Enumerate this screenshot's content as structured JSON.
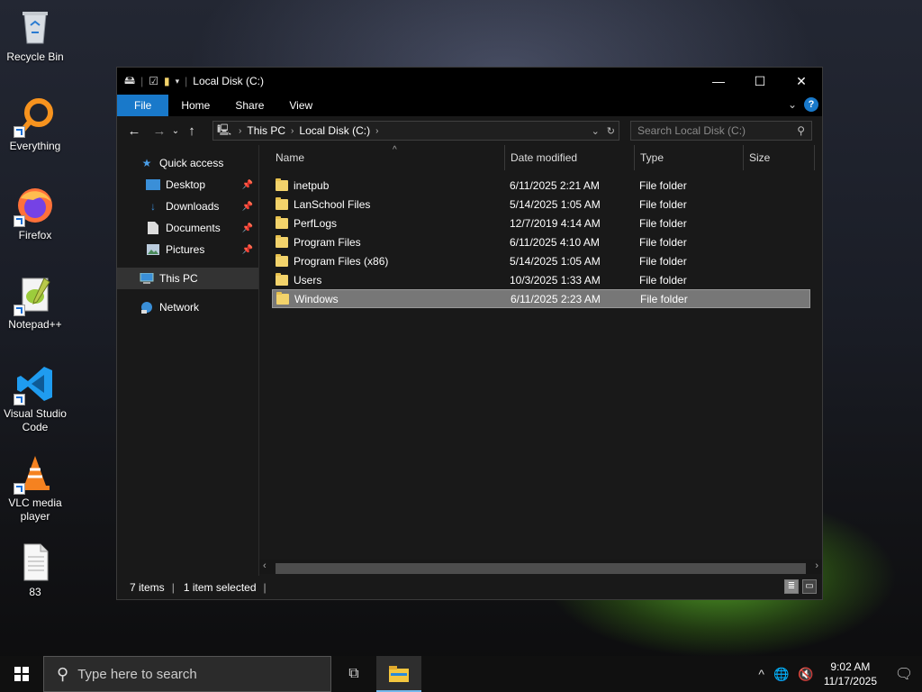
{
  "desktop": {
    "icons": [
      {
        "label": "Recycle Bin"
      },
      {
        "label": "Everything"
      },
      {
        "label": "Firefox"
      },
      {
        "label": "Notepad++"
      },
      {
        "label": "Visual Studio Code"
      },
      {
        "label": "VLC media player"
      },
      {
        "label": "83"
      }
    ]
  },
  "window": {
    "title": "Local Disk (C:)",
    "ribbon_tabs": [
      "File",
      "Home",
      "Share",
      "View"
    ],
    "address": {
      "crumbs": [
        "This PC",
        "Local Disk (C:)"
      ]
    },
    "search": {
      "placeholder": "Search Local Disk (C:)"
    },
    "sidebar": {
      "quick_access": "Quick access",
      "pinned": [
        {
          "label": "Desktop"
        },
        {
          "label": "Downloads"
        },
        {
          "label": "Documents"
        },
        {
          "label": "Pictures"
        }
      ],
      "this_pc": "This PC",
      "network": "Network"
    },
    "columns": [
      "Name",
      "Date modified",
      "Type",
      "Size"
    ],
    "files": [
      {
        "name": "inetpub",
        "date": "6/11/2025 2:21 AM",
        "type": "File folder"
      },
      {
        "name": "LanSchool Files",
        "date": "5/14/2025 1:05 AM",
        "type": "File folder"
      },
      {
        "name": "PerfLogs",
        "date": "12/7/2019 4:14 AM",
        "type": "File folder"
      },
      {
        "name": "Program Files",
        "date": "6/11/2025 4:10 AM",
        "type": "File folder"
      },
      {
        "name": "Program Files (x86)",
        "date": "5/14/2025 1:05 AM",
        "type": "File folder"
      },
      {
        "name": "Users",
        "date": "10/3/2025 1:33 AM",
        "type": "File folder"
      },
      {
        "name": "Windows",
        "date": "6/11/2025 2:23 AM",
        "type": "File folder"
      }
    ],
    "selected_file": "Windows",
    "status": {
      "items": "7 items",
      "selected": "1 item selected"
    }
  },
  "taskbar": {
    "search_placeholder": "Type here to search",
    "time": "9:02 AM",
    "date": "11/17/2025"
  },
  "colors": {
    "accent": "#1979ca",
    "folder": "#f3d36b"
  }
}
